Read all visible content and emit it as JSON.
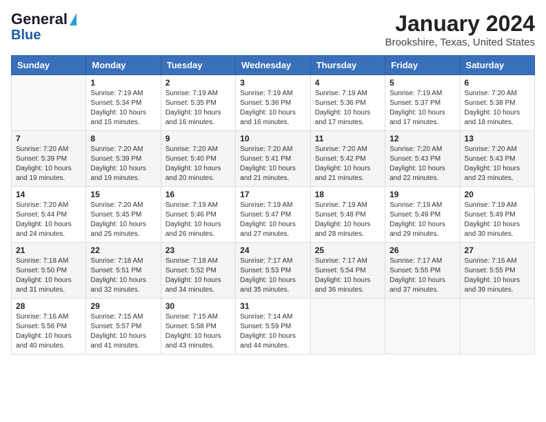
{
  "header": {
    "logo_line1": "General",
    "logo_line2": "Blue",
    "title": "January 2024",
    "subtitle": "Brookshire, Texas, United States"
  },
  "days_of_week": [
    "Sunday",
    "Monday",
    "Tuesday",
    "Wednesday",
    "Thursday",
    "Friday",
    "Saturday"
  ],
  "weeks": [
    [
      {
        "day": "",
        "info": ""
      },
      {
        "day": "1",
        "info": "Sunrise: 7:19 AM\nSunset: 5:34 PM\nDaylight: 10 hours\nand 15 minutes."
      },
      {
        "day": "2",
        "info": "Sunrise: 7:19 AM\nSunset: 5:35 PM\nDaylight: 10 hours\nand 16 minutes."
      },
      {
        "day": "3",
        "info": "Sunrise: 7:19 AM\nSunset: 5:36 PM\nDaylight: 10 hours\nand 16 minutes."
      },
      {
        "day": "4",
        "info": "Sunrise: 7:19 AM\nSunset: 5:36 PM\nDaylight: 10 hours\nand 17 minutes."
      },
      {
        "day": "5",
        "info": "Sunrise: 7:19 AM\nSunset: 5:37 PM\nDaylight: 10 hours\nand 17 minutes."
      },
      {
        "day": "6",
        "info": "Sunrise: 7:20 AM\nSunset: 5:38 PM\nDaylight: 10 hours\nand 18 minutes."
      }
    ],
    [
      {
        "day": "7",
        "info": "Sunrise: 7:20 AM\nSunset: 5:39 PM\nDaylight: 10 hours\nand 19 minutes."
      },
      {
        "day": "8",
        "info": "Sunrise: 7:20 AM\nSunset: 5:39 PM\nDaylight: 10 hours\nand 19 minutes."
      },
      {
        "day": "9",
        "info": "Sunrise: 7:20 AM\nSunset: 5:40 PM\nDaylight: 10 hours\nand 20 minutes."
      },
      {
        "day": "10",
        "info": "Sunrise: 7:20 AM\nSunset: 5:41 PM\nDaylight: 10 hours\nand 21 minutes."
      },
      {
        "day": "11",
        "info": "Sunrise: 7:20 AM\nSunset: 5:42 PM\nDaylight: 10 hours\nand 21 minutes."
      },
      {
        "day": "12",
        "info": "Sunrise: 7:20 AM\nSunset: 5:43 PM\nDaylight: 10 hours\nand 22 minutes."
      },
      {
        "day": "13",
        "info": "Sunrise: 7:20 AM\nSunset: 5:43 PM\nDaylight: 10 hours\nand 23 minutes."
      }
    ],
    [
      {
        "day": "14",
        "info": "Sunrise: 7:20 AM\nSunset: 5:44 PM\nDaylight: 10 hours\nand 24 minutes."
      },
      {
        "day": "15",
        "info": "Sunrise: 7:20 AM\nSunset: 5:45 PM\nDaylight: 10 hours\nand 25 minutes."
      },
      {
        "day": "16",
        "info": "Sunrise: 7:19 AM\nSunset: 5:46 PM\nDaylight: 10 hours\nand 26 minutes."
      },
      {
        "day": "17",
        "info": "Sunrise: 7:19 AM\nSunset: 5:47 PM\nDaylight: 10 hours\nand 27 minutes."
      },
      {
        "day": "18",
        "info": "Sunrise: 7:19 AM\nSunset: 5:48 PM\nDaylight: 10 hours\nand 28 minutes."
      },
      {
        "day": "19",
        "info": "Sunrise: 7:19 AM\nSunset: 5:49 PM\nDaylight: 10 hours\nand 29 minutes."
      },
      {
        "day": "20",
        "info": "Sunrise: 7:19 AM\nSunset: 5:49 PM\nDaylight: 10 hours\nand 30 minutes."
      }
    ],
    [
      {
        "day": "21",
        "info": "Sunrise: 7:18 AM\nSunset: 5:50 PM\nDaylight: 10 hours\nand 31 minutes."
      },
      {
        "day": "22",
        "info": "Sunrise: 7:18 AM\nSunset: 5:51 PM\nDaylight: 10 hours\nand 32 minutes."
      },
      {
        "day": "23",
        "info": "Sunrise: 7:18 AM\nSunset: 5:52 PM\nDaylight: 10 hours\nand 34 minutes."
      },
      {
        "day": "24",
        "info": "Sunrise: 7:17 AM\nSunset: 5:53 PM\nDaylight: 10 hours\nand 35 minutes."
      },
      {
        "day": "25",
        "info": "Sunrise: 7:17 AM\nSunset: 5:54 PM\nDaylight: 10 hours\nand 36 minutes."
      },
      {
        "day": "26",
        "info": "Sunrise: 7:17 AM\nSunset: 5:55 PM\nDaylight: 10 hours\nand 37 minutes."
      },
      {
        "day": "27",
        "info": "Sunrise: 7:16 AM\nSunset: 5:55 PM\nDaylight: 10 hours\nand 39 minutes."
      }
    ],
    [
      {
        "day": "28",
        "info": "Sunrise: 7:16 AM\nSunset: 5:56 PM\nDaylight: 10 hours\nand 40 minutes."
      },
      {
        "day": "29",
        "info": "Sunrise: 7:15 AM\nSunset: 5:57 PM\nDaylight: 10 hours\nand 41 minutes."
      },
      {
        "day": "30",
        "info": "Sunrise: 7:15 AM\nSunset: 5:58 PM\nDaylight: 10 hours\nand 43 minutes."
      },
      {
        "day": "31",
        "info": "Sunrise: 7:14 AM\nSunset: 5:59 PM\nDaylight: 10 hours\nand 44 minutes."
      },
      {
        "day": "",
        "info": ""
      },
      {
        "day": "",
        "info": ""
      },
      {
        "day": "",
        "info": ""
      }
    ]
  ]
}
